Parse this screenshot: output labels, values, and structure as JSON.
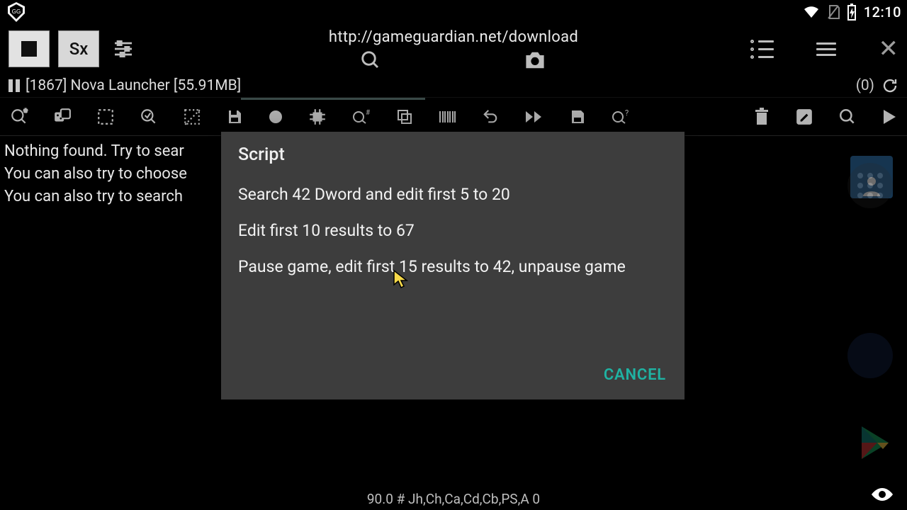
{
  "statusbar": {
    "time": "12:10"
  },
  "topbar": {
    "sx_label": "Sx",
    "url": "http://gameguardian.net/download"
  },
  "process_bar": {
    "text": "[1867] Nova Launcher [55.91MB]",
    "result_count": "(0)"
  },
  "body": {
    "line1": "Nothing found. Try to sear",
    "line2": "You can also try to choose",
    "line3": "You can also try to search"
  },
  "dialog": {
    "title": "Script",
    "items": [
      "Search 42 Dword and edit first 5 to 20",
      "Edit first 10 results to 67",
      "Pause game, edit first 15 results to 42, unpause game"
    ],
    "cancel": "CANCEL"
  },
  "footer": {
    "text": "90.0 # Jh,Ch,Ca,Cd,Cb,PS,A 0"
  }
}
